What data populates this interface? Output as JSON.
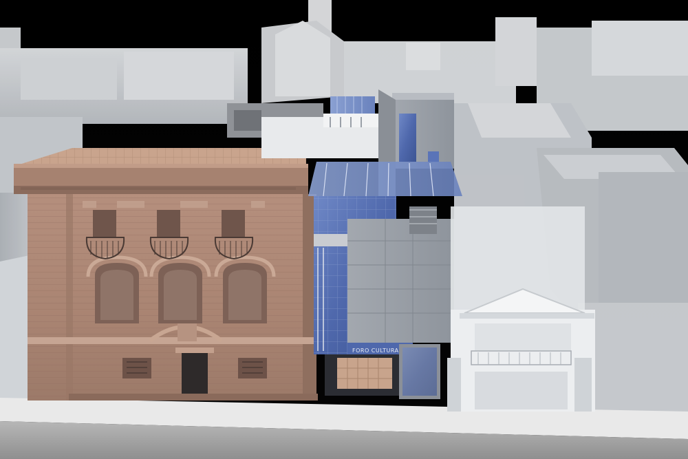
{
  "image": {
    "subject": "architectural-rendering",
    "palette": {
      "sky": "#000000",
      "context_massing": "#cfd3d8",
      "sandstone_facade": "#b08a78",
      "glass": "#5a74b8",
      "steel_panels": "#9aa0a8",
      "street": "#9c9c9c"
    }
  },
  "signage": {
    "entrance_sign": "FORO CULTURAL"
  }
}
